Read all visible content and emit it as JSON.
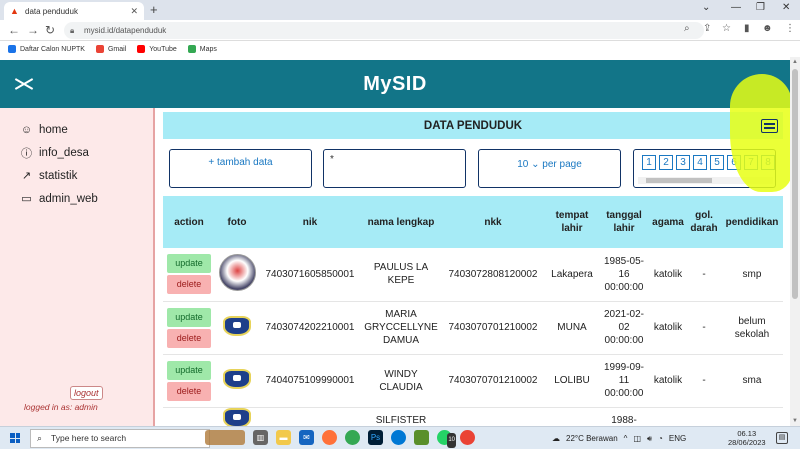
{
  "browser": {
    "tab_title": "data penduduk",
    "url": "mysid.id/datapenduduk",
    "bookmarks": [
      "Daftar Calon NUPTK",
      "Gmail",
      "YouTube",
      "Maps"
    ]
  },
  "app": {
    "title": "MySID",
    "section_title": "DATA PENDUDUK"
  },
  "sidebar": {
    "items": [
      {
        "label": "home",
        "icon": "home-icon"
      },
      {
        "label": "info_desa",
        "icon": "info-icon"
      },
      {
        "label": "statistik",
        "icon": "chart-icon"
      },
      {
        "label": "admin_web",
        "icon": "laptop-icon"
      }
    ],
    "logout_label": "logout",
    "logged_in_text": "logged in as: admin"
  },
  "controls": {
    "add_label": "+ tambah data",
    "search_value": "*",
    "per_page_value": "10",
    "per_page_suffix": "per page",
    "pages": [
      "1",
      "2",
      "3",
      "4",
      "5",
      "6",
      "7",
      "8"
    ]
  },
  "table": {
    "headers": {
      "action": "action",
      "foto": "foto",
      "nik": "nik",
      "nama": "nama lengkap",
      "nkk": "nkk",
      "tempat": "tempat lahir",
      "tanggal": "tanggal lahir",
      "agama": "agama",
      "gol": "gol. darah",
      "pendidikan": "pendidikan"
    },
    "update_label": "update",
    "delete_label": "delete",
    "rows": [
      {
        "nik": "7403071605850001",
        "nama": "PAULUS LA KEPE",
        "nkk": "7403072808120002",
        "tempat": "Lakapera",
        "tanggal": "1985-05-16 00:00:00",
        "agama": "katolik",
        "gol": "-",
        "pendidikan": "smp"
      },
      {
        "nik": "7403074202210001",
        "nama": "MARIA GRYCCELLYNE DAMUA",
        "nkk": "7403070701210002",
        "tempat": "MUNA",
        "tanggal": "2021-02-02 00:00:00",
        "agama": "katolik",
        "gol": "-",
        "pendidikan": "belum sekolah"
      },
      {
        "nik": "7404075109990001",
        "nama": "WINDY CLAUDIA",
        "nkk": "7403070701210002",
        "tempat": "LOLIBU",
        "tanggal": "1999-09-11 00:00:00",
        "agama": "katolik",
        "gol": "-",
        "pendidikan": "sma"
      },
      {
        "nik": "",
        "nama": "SILFISTER",
        "nkk": "",
        "tempat": "",
        "tanggal": "1988-",
        "agama": "",
        "gol": "",
        "pendidikan": ""
      }
    ]
  },
  "taskbar": {
    "search_placeholder": "Type here to search",
    "weather": "22°C  Berawan",
    "lang": "ENG",
    "time": "06.13",
    "date": "28/06/2023",
    "whatsapp_badge": "10"
  },
  "colors": {
    "header": "#127588",
    "accent": "#a6ebf6",
    "highlight": "#e8ff14"
  }
}
